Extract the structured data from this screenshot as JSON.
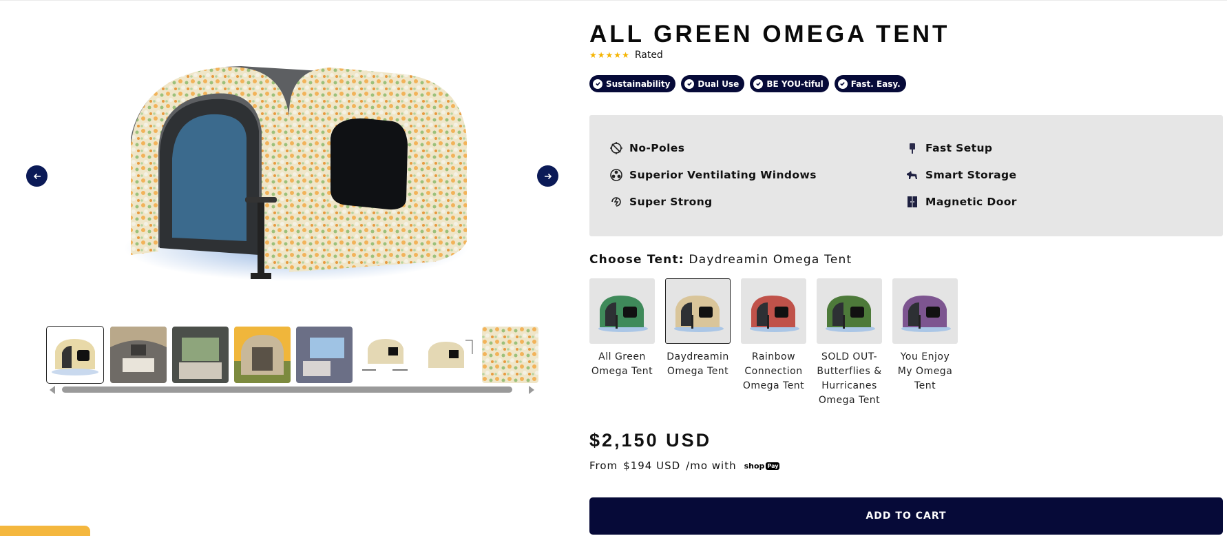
{
  "product": {
    "title": "ALL GREEN OMEGA TENT",
    "rating_text": "Rated",
    "stars": 5
  },
  "badges": [
    {
      "label": "Sustainability"
    },
    {
      "label": "Dual Use"
    },
    {
      "label": "BE YOU-tiful"
    },
    {
      "label": "Fast. Easy."
    }
  ],
  "features": {
    "left": [
      {
        "label": "No-Poles",
        "icon": "no-poles-icon"
      },
      {
        "label": "Superior Ventilating Windows",
        "icon": "ventilation-icon"
      },
      {
        "label": "Super Strong",
        "icon": "strength-icon"
      }
    ],
    "right": [
      {
        "label": "Fast Setup",
        "icon": "pump-icon"
      },
      {
        "label": "Smart Storage",
        "icon": "dog-icon"
      },
      {
        "label": "Magnetic Door",
        "icon": "door-icon"
      }
    ]
  },
  "chooser": {
    "label": "Choose Tent:",
    "selected": "Daydreamin Omega Tent"
  },
  "variants": [
    {
      "label": "All Green Omega Tent",
      "color": "#3f8a5a"
    },
    {
      "label": "Daydreamin Omega Tent",
      "color": "#d9c59a",
      "selected": true
    },
    {
      "label": "Rainbow Connection Omega Tent",
      "color": "#c0524a"
    },
    {
      "label": "SOLD OUT-Butterflies & Hurricanes Omega Tent",
      "color": "#4d7a3a"
    },
    {
      "label": "You Enjoy My Omega Tent",
      "color": "#7d5590"
    }
  ],
  "pricing": {
    "price": "$2,150 USD",
    "installment_prefix": "From",
    "installment_amount": "$194 USD",
    "installment_suffix": "/mo with",
    "shop_label": "shop",
    "pay_label": "Pay"
  },
  "cart": {
    "label": "ADD TO CART"
  },
  "colors": {
    "navy": "#060a38",
    "star": "#f5b400",
    "panel": "#e6e6e6",
    "accent_tab": "#f4b73e"
  }
}
